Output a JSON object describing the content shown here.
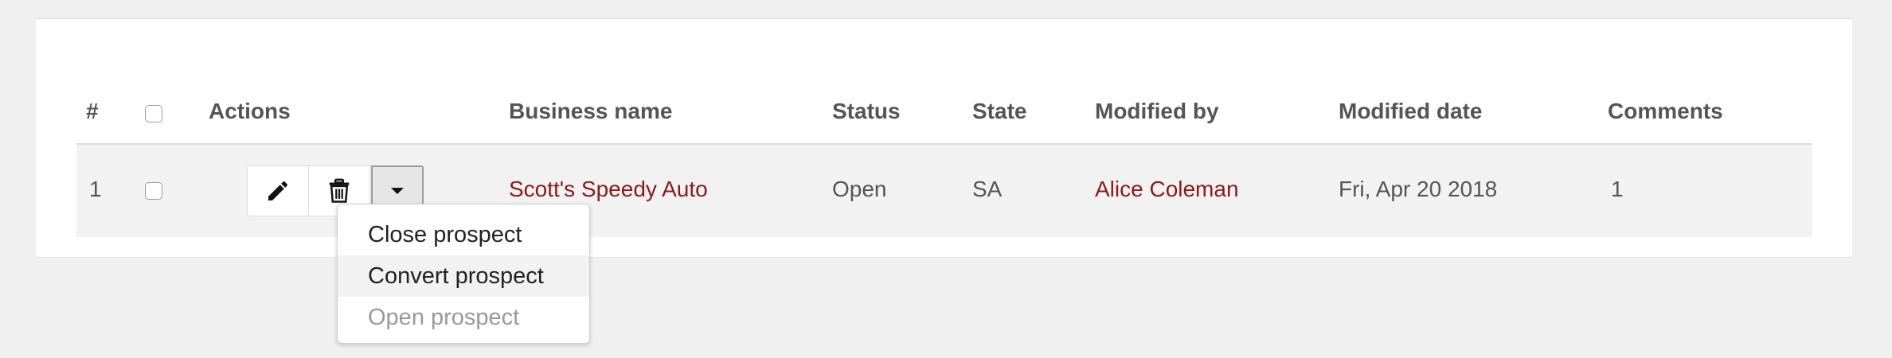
{
  "table": {
    "columns": {
      "index": "#",
      "actions": "Actions",
      "business_name": "Business name",
      "status": "Status",
      "state": "State",
      "modified_by": "Modified by",
      "modified_date": "Modified date",
      "comments": "Comments"
    },
    "rows": [
      {
        "index": "1",
        "business_name": "Scott's Speedy Auto",
        "status": "Open",
        "state": "SA",
        "modified_by": "Alice Coleman",
        "modified_date": "Fri, Apr 20 2018",
        "comments": "1"
      }
    ],
    "row_actions": {
      "edit_icon": "pencil-icon",
      "delete_icon": "trash-icon",
      "toggle_icon": "caret-down-icon"
    }
  },
  "dropdown": {
    "items": [
      {
        "label": "Close prospect",
        "state": "normal"
      },
      {
        "label": "Convert prospect",
        "state": "hover"
      },
      {
        "label": "Open prospect",
        "state": "disabled"
      }
    ]
  },
  "colors": {
    "link": "#8a1a1a",
    "text": "#555555",
    "header_text": "#555555",
    "page_background": "#f0f0f0",
    "row_background": "#f2f2f2"
  }
}
